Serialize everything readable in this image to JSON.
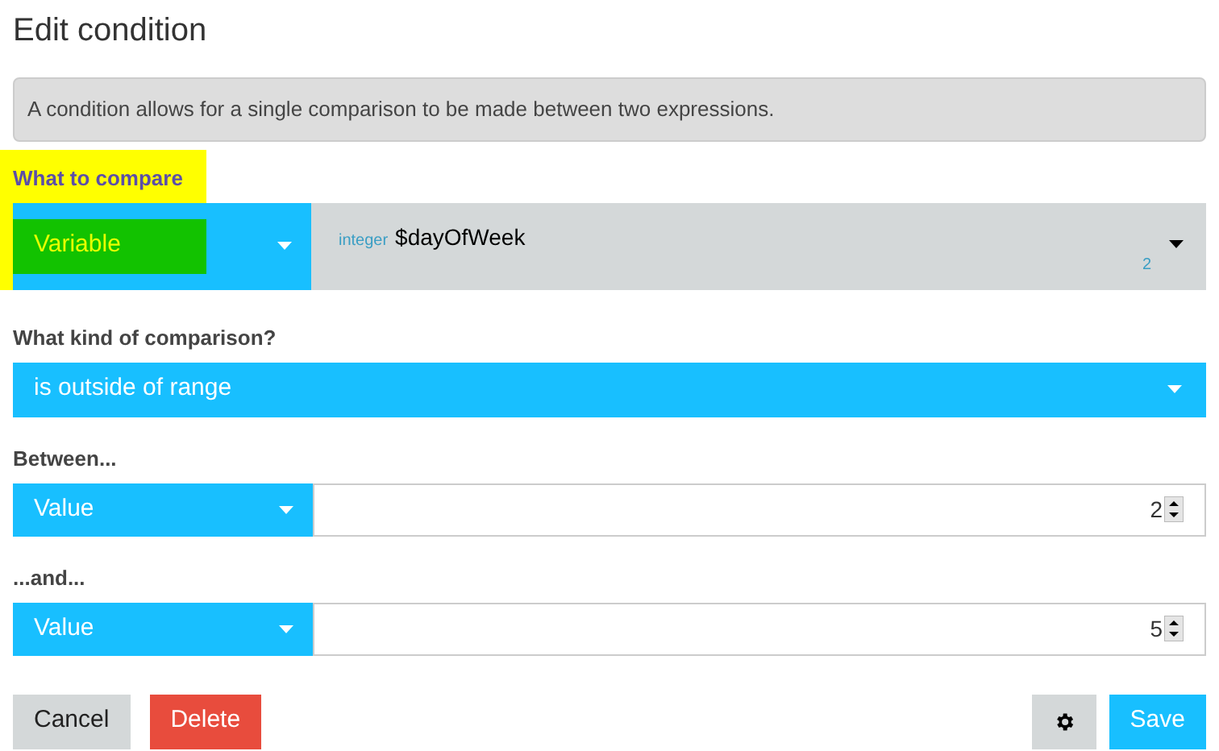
{
  "title": "Edit condition",
  "info": "A condition allows for a single comparison to be made between two expressions.",
  "compare": {
    "label": "What to compare",
    "highlighted": true,
    "source": "Variable",
    "var_type": "integer",
    "var_name": "$dayOfWeek",
    "var_value": "2"
  },
  "comparison": {
    "label": "What kind of comparison?",
    "value": "is outside of range"
  },
  "operands": [
    {
      "label": "Between...",
      "source": "Value",
      "value": "2"
    },
    {
      "label": "...and...",
      "source": "Value",
      "value": "5"
    }
  ],
  "buttons": {
    "cancel": "Cancel",
    "delete": "Delete",
    "save": "Save"
  }
}
